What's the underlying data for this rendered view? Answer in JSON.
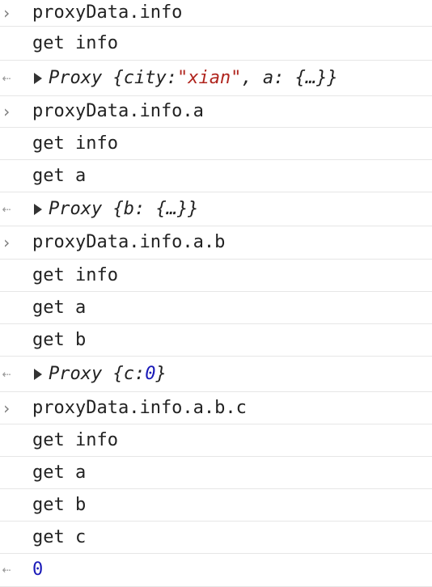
{
  "console": {
    "icons": {
      "prompt": "chevron-right-icon",
      "result": "return-arrow-icon",
      "expand": "triangle-right-icon"
    },
    "colors": {
      "string": "#b0251e",
      "number": "#1a1ab8",
      "divider": "#e6e6e6"
    },
    "entries": [
      {
        "input": "proxyData.info",
        "logs": [
          "get info"
        ],
        "result": {
          "kind": "object",
          "prefix": "Proxy {city: ",
          "string": "\"xian\"",
          "suffix": ", a: {…}}"
        }
      },
      {
        "input": "proxyData.info.a",
        "logs": [
          "get info",
          "get a"
        ],
        "result": {
          "kind": "object",
          "prefix": "Proxy {b: {…}}"
        }
      },
      {
        "input": "proxyData.info.a.b",
        "logs": [
          "get info",
          "get a",
          "get b"
        ],
        "result": {
          "kind": "object",
          "prefix": "Proxy {c: ",
          "number": "0",
          "suffix": "}"
        }
      },
      {
        "input": "proxyData.info.a.b.c",
        "logs": [
          "get info",
          "get a",
          "get b",
          "get c"
        ],
        "result": {
          "kind": "number",
          "value": "0"
        }
      }
    ]
  }
}
